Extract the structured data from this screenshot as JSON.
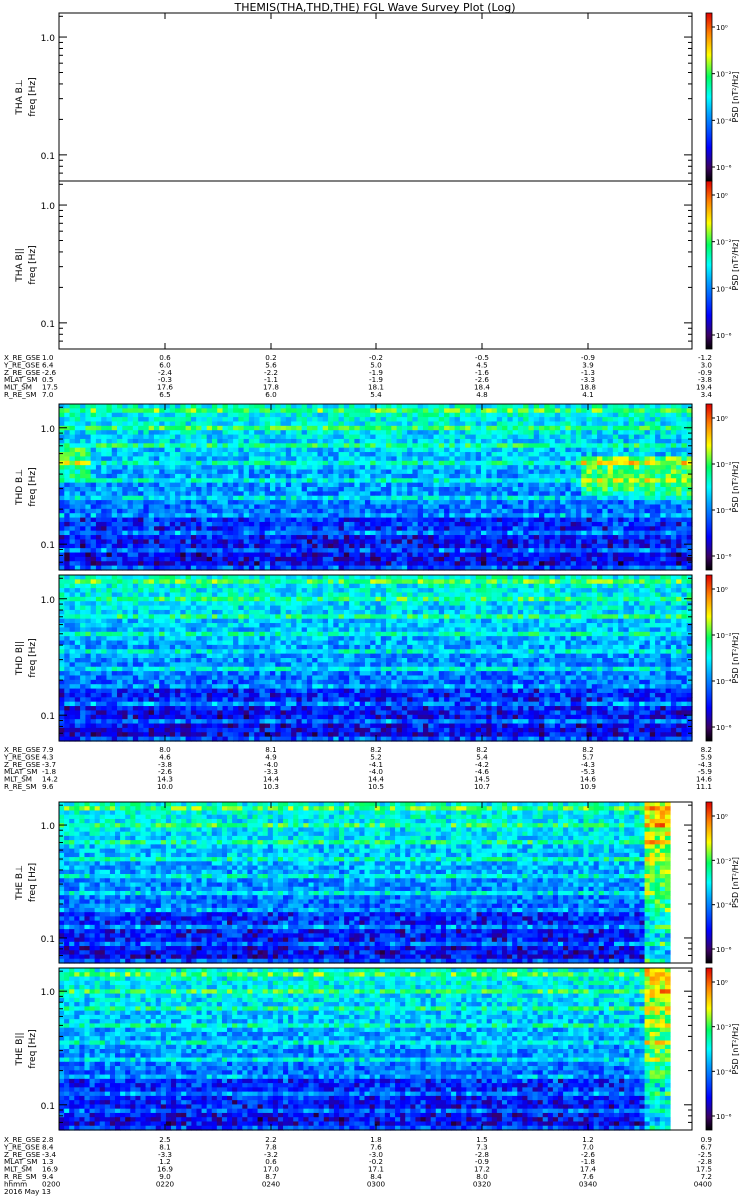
{
  "chart_data": {
    "type": "heatmap",
    "title": "THEMIS(THA,THD,THE) FGL Wave Survey Plot (Log)",
    "freq_ylim_hz": [
      0.06,
      1.6
    ],
    "freq_scale": "log",
    "freq_tick_labels": [
      "1.0",
      "0.1"
    ],
    "colorbar": {
      "label": "PSD [nT²/Hz]",
      "scale": "log",
      "ticks": [
        "10⁰",
        "10⁻²",
        "10⁻⁴",
        "10⁻⁶"
      ]
    },
    "probes": [
      {
        "probe": "THA",
        "panels": [
          {
            "name": "bperp",
            "ylabel1": "THA B⊥",
            "ylabel2": "freq [Hz]",
            "has_data": false
          },
          {
            "name": "bpar",
            "ylabel1": "THA B||",
            "ylabel2": "freq [Hz]",
            "has_data": false
          }
        ],
        "ephemeris": [
          {
            "label": "X_RE_GSE",
            "values": [
              "1.0",
              "0.6",
              "0.2",
              "-0.2",
              "-0.5",
              "-0.9",
              "-1.2"
            ]
          },
          {
            "label": "Y_RE_GSE",
            "values": [
              "6.4",
              "6.0",
              "5.6",
              "5.0",
              "4.5",
              "3.9",
              "3.0"
            ]
          },
          {
            "label": "Z_RE_GSE",
            "values": [
              "-2.6",
              "-2.4",
              "-2.2",
              "-1.9",
              "-1.6",
              "-1.3",
              "-0.9"
            ]
          },
          {
            "label": "MLAT_SM",
            "values": [
              "0.5",
              "-0.3",
              "-1.1",
              "-1.9",
              "-2.6",
              "-3.3",
              "-3.8"
            ]
          },
          {
            "label": "MLT_SM",
            "values": [
              "17.5",
              "17.6",
              "17.8",
              "18.1",
              "18.4",
              "18.8",
              "19.4"
            ]
          },
          {
            "label": "R_RE_SM",
            "values": [
              "7.0",
              "6.5",
              "6.0",
              "5.4",
              "4.8",
              "4.1",
              "3.4"
            ]
          }
        ]
      },
      {
        "probe": "THD",
        "panels": [
          {
            "name": "bperp",
            "ylabel1": "THD B⊥",
            "ylabel2": "freq [Hz]",
            "has_data": true
          },
          {
            "name": "bpar",
            "ylabel1": "THD B||",
            "ylabel2": "freq [Hz]",
            "has_data": true
          }
        ],
        "ephemeris": [
          {
            "label": "X_RE_GSE",
            "values": [
              "7.9",
              "8.0",
              "8.1",
              "8.2",
              "8.2",
              "8.2",
              "8.2"
            ]
          },
          {
            "label": "Y_RE_GSE",
            "values": [
              "4.3",
              "4.6",
              "4.9",
              "5.2",
              "5.4",
              "5.7",
              "5.9"
            ]
          },
          {
            "label": "Z_RE_GSE",
            "values": [
              "-3.7",
              "-3.8",
              "-4.0",
              "-4.1",
              "-4.2",
              "-4.3",
              "-4.3"
            ]
          },
          {
            "label": "MLAT_SM",
            "values": [
              "-1.8",
              "-2.6",
              "-3.3",
              "-4.0",
              "-4.6",
              "-5.3",
              "-5.9"
            ]
          },
          {
            "label": "MLT_SM",
            "values": [
              "14.2",
              "14.3",
              "14.4",
              "14.4",
              "14.5",
              "14.6",
              "14.6"
            ]
          },
          {
            "label": "R_RE_SM",
            "values": [
              "9.6",
              "10.0",
              "10.3",
              "10.5",
              "10.7",
              "10.9",
              "11.1"
            ]
          }
        ]
      },
      {
        "probe": "THE",
        "panels": [
          {
            "name": "bperp",
            "ylabel1": "THE B⊥",
            "ylabel2": "freq [Hz]",
            "has_data": true
          },
          {
            "name": "bpar",
            "ylabel1": "THE B||",
            "ylabel2": "freq [Hz]",
            "has_data": true
          }
        ],
        "ephemeris": [
          {
            "label": "X_RE_GSE",
            "values": [
              "2.8",
              "2.5",
              "2.2",
              "1.8",
              "1.5",
              "1.2",
              "0.9"
            ]
          },
          {
            "label": "Y_RE_GSE",
            "values": [
              "8.4",
              "8.1",
              "7.8",
              "7.6",
              "7.3",
              "7.0",
              "6.7"
            ]
          },
          {
            "label": "Z_RE_GSE",
            "values": [
              "-3.4",
              "-3.3",
              "-3.2",
              "-3.0",
              "-2.8",
              "-2.6",
              "-2.5"
            ]
          },
          {
            "label": "MLAT_SM",
            "values": [
              "1.3",
              "1.2",
              "0.6",
              "-0.2",
              "-0.9",
              "-1.8",
              "-2.8"
            ]
          },
          {
            "label": "MLT_SM",
            "values": [
              "16.9",
              "16.9",
              "17.0",
              "17.1",
              "17.2",
              "17.4",
              "17.5"
            ]
          },
          {
            "label": "R_RE_SM",
            "values": [
              "9.4",
              "9.0",
              "8.7",
              "8.4",
              "8.0",
              "7.6",
              "7.2"
            ]
          },
          {
            "label": "hhmm",
            "values": [
              "0200",
              "0220",
              "0240",
              "0300",
              "0320",
              "0340",
              "0400"
            ]
          }
        ],
        "date_label": "2016 May 13"
      }
    ]
  }
}
